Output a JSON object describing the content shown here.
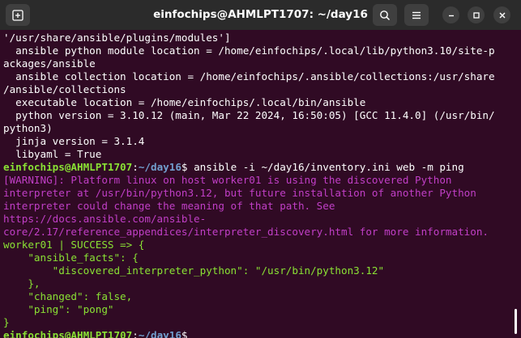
{
  "window": {
    "title": "einfochips@AHMLPT1707: ~/day16",
    "new_tab_icon": "new-tab-icon",
    "search_icon": "search-icon",
    "menu_icon": "hamburger-menu-icon",
    "minimize_icon": "minimize-icon",
    "maximize_icon": "maximize-icon",
    "close_icon": "close-icon"
  },
  "colors": {
    "background": "#300a24",
    "titlebar": "#2b2b2b",
    "prompt_user": "#8ae234",
    "prompt_path": "#729fcf",
    "warning": "#c13fc7",
    "success": "#8ae234",
    "text": "#ffffff"
  },
  "terminal": {
    "lines": [
      {
        "segments": [
          {
            "text": "'/usr/share/ansible/plugins/modules']",
            "color": "white"
          }
        ]
      },
      {
        "segments": [
          {
            "text": "  ansible python module location = /home/einfochips/.local/lib/python3.10/site-p",
            "color": "white"
          }
        ]
      },
      {
        "segments": [
          {
            "text": "ackages/ansible",
            "color": "white"
          }
        ]
      },
      {
        "segments": [
          {
            "text": "  ansible collection location = /home/einfochips/.ansible/collections:/usr/share",
            "color": "white"
          }
        ]
      },
      {
        "segments": [
          {
            "text": "/ansible/collections",
            "color": "white"
          }
        ]
      },
      {
        "segments": [
          {
            "text": "  executable location = /home/einfochips/.local/bin/ansible",
            "color": "white"
          }
        ]
      },
      {
        "segments": [
          {
            "text": "  python version = 3.10.12 (main, Mar 22 2024, 16:50:05) [GCC 11.4.0] (/usr/bin/",
            "color": "white"
          }
        ]
      },
      {
        "segments": [
          {
            "text": "python3)",
            "color": "white"
          }
        ]
      },
      {
        "segments": [
          {
            "text": "  jinja version = 3.1.4",
            "color": "white"
          }
        ]
      },
      {
        "segments": [
          {
            "text": "  libyaml = True",
            "color": "white"
          }
        ]
      },
      {
        "segments": [
          {
            "text": "einfochips@AHMLPT1707",
            "color": "green"
          },
          {
            "text": ":",
            "color": "white"
          },
          {
            "text": "~/day16",
            "color": "blue"
          },
          {
            "text": "$ ansible -i ~/day16/inventory.ini web -m ping",
            "color": "prompt"
          }
        ]
      },
      {
        "segments": [
          {
            "text": "[WARNING]: Platform linux on host worker01 is using the discovered Python",
            "color": "purple"
          }
        ]
      },
      {
        "segments": [
          {
            "text": "interpreter at /usr/bin/python3.12, but future installation of another Python",
            "color": "purple"
          }
        ]
      },
      {
        "segments": [
          {
            "text": "interpreter could change the meaning of that path. See",
            "color": "purple"
          }
        ]
      },
      {
        "segments": [
          {
            "text": "https://docs.ansible.com/ansible-",
            "color": "purple"
          }
        ]
      },
      {
        "segments": [
          {
            "text": "core/2.17/reference_appendices/interpreter_discovery.html for more information.",
            "color": "purple"
          }
        ]
      },
      {
        "segments": [
          {
            "text": "worker01 | SUCCESS => {",
            "color": "ok"
          }
        ]
      },
      {
        "segments": [
          {
            "text": "    \"ansible_facts\": {",
            "color": "ok"
          }
        ]
      },
      {
        "segments": [
          {
            "text": "        \"discovered_interpreter_python\": \"/usr/bin/python3.12\"",
            "color": "ok"
          }
        ]
      },
      {
        "segments": [
          {
            "text": "    },",
            "color": "ok"
          }
        ]
      },
      {
        "segments": [
          {
            "text": "    \"changed\": false,",
            "color": "ok"
          }
        ]
      },
      {
        "segments": [
          {
            "text": "    \"ping\": \"pong\"",
            "color": "ok"
          }
        ]
      },
      {
        "segments": [
          {
            "text": "}",
            "color": "ok"
          }
        ]
      },
      {
        "segments": [
          {
            "text": "einfochips@AHMLPT1707",
            "color": "green"
          },
          {
            "text": ":",
            "color": "white"
          },
          {
            "text": "~/day16",
            "color": "blue"
          },
          {
            "text": "$ ",
            "color": "prompt"
          }
        ]
      }
    ]
  }
}
